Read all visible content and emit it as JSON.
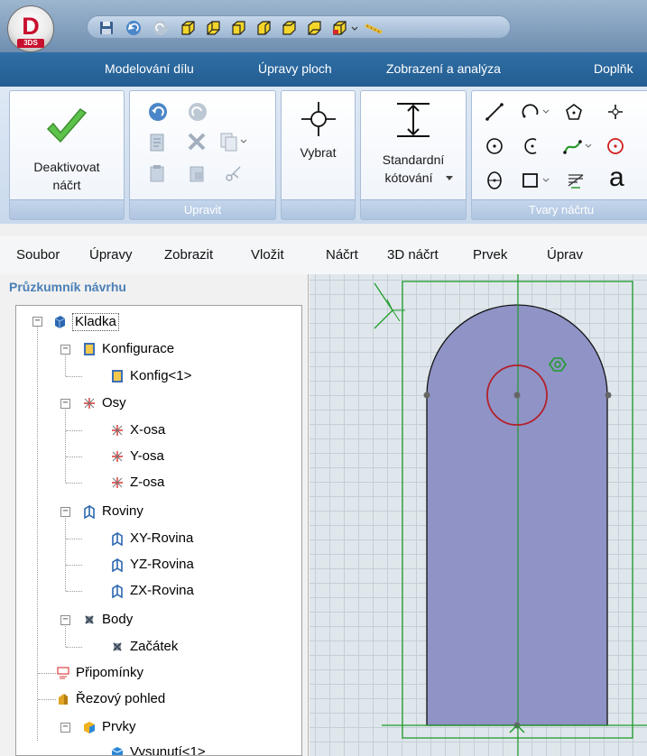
{
  "app": {
    "logo_letter": "D",
    "logo_sub": "3DS"
  },
  "ribbon_tabs": [
    "Modelování dílu",
    "Úpravy ploch",
    "Zobrazení a analýza",
    "Doplňk"
  ],
  "ribbon": {
    "deactivate_line1": "Deaktivovat",
    "deactivate_line2": "náčrt",
    "edit_group": "Upravit",
    "select_label": "Vybrat",
    "dimension_line1": "Standardní",
    "dimension_line2": "kótování",
    "shapes_group": "Tvary náčrtu",
    "text_tool_glyph": "a"
  },
  "menu": [
    "Soubor",
    "Úpravy",
    "Zobrazit",
    "Vložit",
    "Náčrt",
    "3D náčrt",
    "Prvek",
    "Úprav"
  ],
  "panel": {
    "title": "Průzkumník návrhu"
  },
  "tree": {
    "root": "Kladka",
    "config_folder": "Konfigurace",
    "config_item": "Konfig<1>",
    "axes_folder": "Osy",
    "axis_x": "X-osa",
    "axis_y": "Y-osa",
    "axis_z": "Z-osa",
    "planes_folder": "Roviny",
    "plane_xy": "XY-Rovina",
    "plane_yz": "YZ-Rovina",
    "plane_zx": "ZX-Rovina",
    "points_folder": "Body",
    "point_origin": "Začátek",
    "notes": "Připomínky",
    "section_view": "Řezový pohled",
    "features_folder": "Prvky",
    "extrude": "Vysunutí<1>"
  },
  "colors": {
    "tab_bar": "#2a66a0",
    "shape_fill": "#8f93c6",
    "sketch_green": "#1f9c2a",
    "circle_red": "#b3202a"
  }
}
